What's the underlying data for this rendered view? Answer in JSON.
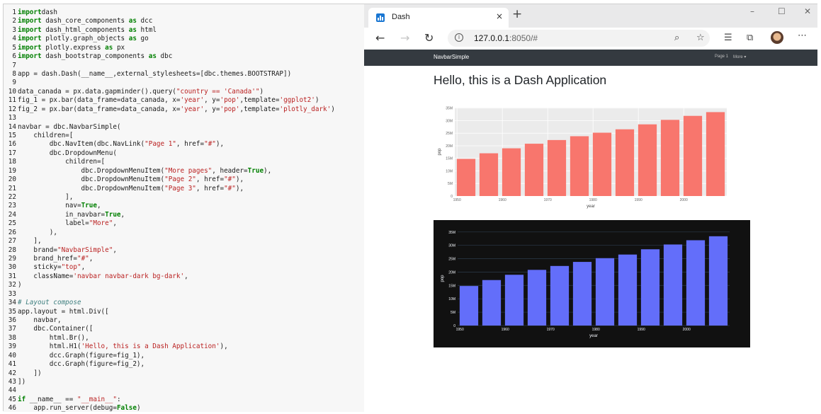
{
  "code_editor": {
    "lines": [
      {
        "n": "1",
        "t": [
          [
            "k",
            "import"
          ],
          [
            "",
            "dash"
          ]
        ]
      },
      {
        "n": "2",
        "t": [
          [
            "k",
            "import"
          ],
          [
            "",
            " dash_core_components "
          ],
          [
            "k",
            "as"
          ],
          [
            "",
            " dcc"
          ]
        ]
      },
      {
        "n": "3",
        "t": [
          [
            "k",
            "import"
          ],
          [
            "",
            " dash_html_components "
          ],
          [
            "k",
            "as"
          ],
          [
            "",
            " html"
          ]
        ]
      },
      {
        "n": "4",
        "t": [
          [
            "k",
            "import"
          ],
          [
            "",
            " plotly.graph_objects "
          ],
          [
            "k",
            "as"
          ],
          [
            "",
            " go"
          ]
        ]
      },
      {
        "n": "5",
        "t": [
          [
            "k",
            "import"
          ],
          [
            "",
            " plotly.express "
          ],
          [
            "k",
            "as"
          ],
          [
            "",
            " px"
          ]
        ]
      },
      {
        "n": "6",
        "t": [
          [
            "k",
            "import"
          ],
          [
            "",
            " dash_bootstrap_components "
          ],
          [
            "k",
            "as"
          ],
          [
            "",
            " dbc"
          ]
        ]
      },
      {
        "n": "7",
        "t": []
      },
      {
        "n": "8",
        "t": [
          [
            "",
            "app = dash.Dash(__name__,external_stylesheets=[dbc.themes.BOOTSTRAP])"
          ]
        ]
      },
      {
        "n": "9",
        "t": []
      },
      {
        "n": "10",
        "t": [
          [
            "",
            "data_canada = px.data.gapminder().query("
          ],
          [
            "s",
            "\"country == 'Canada'\""
          ],
          [
            "",
            ")"
          ]
        ]
      },
      {
        "n": "11",
        "t": [
          [
            "",
            "fig_1 = px.bar(data_frame=data_canada, x="
          ],
          [
            "s",
            "'year'"
          ],
          [
            "",
            ", y="
          ],
          [
            "s",
            "'pop'"
          ],
          [
            "",
            ",template="
          ],
          [
            "s",
            "'ggplot2'"
          ],
          [
            "",
            ")"
          ]
        ]
      },
      {
        "n": "12",
        "t": [
          [
            "",
            "fig_2 = px.bar(data_frame=data_canada, x="
          ],
          [
            "s",
            "'year'"
          ],
          [
            "",
            ", y="
          ],
          [
            "s",
            "'pop'"
          ],
          [
            "",
            ",template="
          ],
          [
            "s",
            "'plotly_dark'"
          ],
          [
            "",
            ")"
          ]
        ]
      },
      {
        "n": "13",
        "t": []
      },
      {
        "n": "14",
        "t": [
          [
            "",
            "navbar = dbc.NavbarSimple("
          ]
        ]
      },
      {
        "n": "15",
        "t": [
          [
            "",
            "    children=["
          ]
        ]
      },
      {
        "n": "16",
        "t": [
          [
            "",
            "        dbc.NavItem(dbc.NavLink("
          ],
          [
            "s",
            "\"Page 1\""
          ],
          [
            "",
            ", href="
          ],
          [
            "s",
            "\"#\""
          ],
          [
            "",
            "),"
          ]
        ]
      },
      {
        "n": "17",
        "t": [
          [
            "",
            "        dbc.DropdownMenu("
          ]
        ]
      },
      {
        "n": "18",
        "t": [
          [
            "",
            "            children=["
          ]
        ]
      },
      {
        "n": "19",
        "t": [
          [
            "",
            "                dbc.DropdownMenuItem("
          ],
          [
            "s",
            "\"More pages\""
          ],
          [
            "",
            ", header="
          ],
          [
            "k",
            "True"
          ],
          [
            "",
            "),"
          ]
        ]
      },
      {
        "n": "20",
        "t": [
          [
            "",
            "                dbc.DropdownMenuItem("
          ],
          [
            "s",
            "\"Page 2\""
          ],
          [
            "",
            ", href="
          ],
          [
            "s",
            "\"#\""
          ],
          [
            "",
            "),"
          ]
        ]
      },
      {
        "n": "21",
        "t": [
          [
            "",
            "                dbc.DropdownMenuItem("
          ],
          [
            "s",
            "\"Page 3\""
          ],
          [
            "",
            ", href="
          ],
          [
            "s",
            "\"#\""
          ],
          [
            "",
            "),"
          ]
        ]
      },
      {
        "n": "22",
        "t": [
          [
            "",
            "            ],"
          ]
        ]
      },
      {
        "n": "23",
        "t": [
          [
            "",
            "            nav="
          ],
          [
            "k",
            "True"
          ],
          [
            "",
            ","
          ]
        ]
      },
      {
        "n": "24",
        "t": [
          [
            "",
            "            in_navbar="
          ],
          [
            "k",
            "True"
          ],
          [
            "",
            ","
          ]
        ]
      },
      {
        "n": "25",
        "t": [
          [
            "",
            "            label="
          ],
          [
            "s",
            "\"More\""
          ],
          [
            "",
            ","
          ]
        ]
      },
      {
        "n": "26",
        "t": [
          [
            "",
            "        ),"
          ]
        ]
      },
      {
        "n": "27",
        "t": [
          [
            "",
            "    ],"
          ]
        ]
      },
      {
        "n": "28",
        "t": [
          [
            "",
            "    brand="
          ],
          [
            "s",
            "\"NavbarSimple\""
          ],
          [
            "",
            ","
          ]
        ]
      },
      {
        "n": "29",
        "t": [
          [
            "",
            "    brand_href="
          ],
          [
            "s",
            "\"#\""
          ],
          [
            "",
            ","
          ]
        ]
      },
      {
        "n": "30",
        "t": [
          [
            "",
            "    sticky="
          ],
          [
            "s",
            "\"top\""
          ],
          [
            "",
            ","
          ]
        ]
      },
      {
        "n": "31",
        "t": [
          [
            "",
            "    className="
          ],
          [
            "s",
            "'navbar navbar-dark bg-dark'"
          ],
          [
            "",
            ","
          ]
        ]
      },
      {
        "n": "32",
        "t": [
          [
            "",
            ")"
          ]
        ]
      },
      {
        "n": "33",
        "t": []
      },
      {
        "n": "34",
        "t": [
          [
            "c",
            "# Layout compose"
          ]
        ]
      },
      {
        "n": "35",
        "t": [
          [
            "",
            "app.layout = html.Div(["
          ]
        ]
      },
      {
        "n": "36",
        "t": [
          [
            "",
            "    navbar,"
          ]
        ]
      },
      {
        "n": "37",
        "t": [
          [
            "",
            "    dbc.Container(["
          ]
        ]
      },
      {
        "n": "38",
        "t": [
          [
            "",
            "        html.Br(),"
          ]
        ]
      },
      {
        "n": "39",
        "t": [
          [
            "",
            "        html.H1("
          ],
          [
            "s",
            "'Hello, this is a Dash Application'"
          ],
          [
            "",
            "),"
          ]
        ]
      },
      {
        "n": "40",
        "t": [
          [
            "",
            "        dcc.Graph(figure=fig_1),"
          ]
        ]
      },
      {
        "n": "41",
        "t": [
          [
            "",
            "        dcc.Graph(figure=fig_2),"
          ]
        ]
      },
      {
        "n": "42",
        "t": [
          [
            "",
            "    ])"
          ]
        ]
      },
      {
        "n": "43",
        "t": [
          [
            "",
            "])"
          ]
        ]
      },
      {
        "n": "44",
        "t": []
      },
      {
        "n": "45",
        "t": [
          [
            "k",
            "if"
          ],
          [
            "",
            " __name__ == "
          ],
          [
            "s",
            "\"__main__\""
          ],
          [
            "",
            ":"
          ]
        ]
      },
      {
        "n": "46",
        "t": [
          [
            "",
            "    app.run_server(debug="
          ],
          [
            "k",
            "False"
          ],
          [
            "",
            ")"
          ]
        ]
      }
    ]
  },
  "browser": {
    "tab_title": "Dash",
    "tab_close": "×",
    "new_tab": "+",
    "url_host": "127.0.0.1",
    "url_rest": ":8050/#",
    "info_glyph": "i",
    "icons": [
      "back-icon",
      "forward-icon",
      "refresh-icon",
      "info-icon",
      "zoom-icon",
      "favorite-star-icon",
      "favorites-icon",
      "collections-icon",
      "profile-avatar",
      "more-icon",
      "minimize-icon",
      "maximize-icon",
      "close-icon"
    ]
  },
  "page": {
    "navbar": {
      "brand": "NavbarSimple",
      "link1": "Page 1",
      "dropdown": "More ▾"
    },
    "heading": "Hello, this is a Dash Application"
  },
  "chart_data": [
    {
      "type": "bar",
      "template": "ggplot2",
      "categories": [
        1952,
        1957,
        1962,
        1967,
        1972,
        1977,
        1982,
        1987,
        1992,
        1997,
        2002,
        2007
      ],
      "values": [
        14.79,
        17.01,
        18.99,
        20.82,
        22.28,
        23.8,
        25.2,
        26.55,
        28.52,
        30.31,
        31.9,
        33.39
      ],
      "value_unit": "M",
      "xlabel": "year",
      "ylabel": "pop",
      "xticks": [
        "1950",
        "1960",
        "1970",
        "1980",
        "1990",
        "2000"
      ],
      "yticks": [
        "0",
        "5M",
        "10M",
        "15M",
        "20M",
        "25M",
        "30M",
        "35M"
      ],
      "ylim": [
        0,
        35.2
      ],
      "xlim": [
        1949.5,
        2009.5
      ],
      "bar_color": "#f8766d",
      "plot_bg": "#ebebeb",
      "paper_bg": "#ffffff",
      "grid": true
    },
    {
      "type": "bar",
      "template": "plotly_dark",
      "categories": [
        1952,
        1957,
        1962,
        1967,
        1972,
        1977,
        1982,
        1987,
        1992,
        1997,
        2002,
        2007
      ],
      "values": [
        14.79,
        17.01,
        18.99,
        20.82,
        22.28,
        23.8,
        25.2,
        26.55,
        28.52,
        30.31,
        31.9,
        33.39
      ],
      "value_unit": "M",
      "xlabel": "year",
      "ylabel": "pop",
      "xticks": [
        "1950",
        "1960",
        "1970",
        "1980",
        "1990",
        "2000"
      ],
      "yticks": [
        "0",
        "5M",
        "10M",
        "15M",
        "20M",
        "25M",
        "30M",
        "35M"
      ],
      "ylim": [
        0,
        35.2
      ],
      "xlim": [
        1949.5,
        2009.5
      ],
      "bar_color": "#636efa",
      "plot_bg": "#111111",
      "paper_bg": "#111111",
      "grid": true
    }
  ]
}
